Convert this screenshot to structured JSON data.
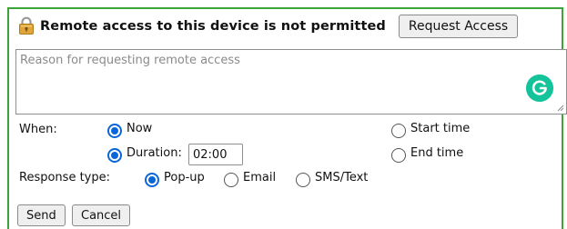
{
  "header": {
    "title": "Remote access to this device is not permitted",
    "request_button": "Request Access",
    "icon": "lock-icon"
  },
  "reason": {
    "placeholder": "Reason for requesting remote access",
    "value": ""
  },
  "when": {
    "label": "When:",
    "now_label": "Now",
    "now_selected": true,
    "duration_label": "Duration:",
    "duration_selected": true,
    "duration_value": "02:00",
    "start_time_label": "Start time",
    "start_time_selected": false,
    "end_time_label": "End time",
    "end_time_selected": false
  },
  "response": {
    "label": "Response type:",
    "options": [
      {
        "label": "Pop-up",
        "selected": true
      },
      {
        "label": "Email",
        "selected": false
      },
      {
        "label": "SMS/Text",
        "selected": false
      }
    ]
  },
  "actions": {
    "send": "Send",
    "cancel": "Cancel"
  },
  "colors": {
    "frame_border": "#3aa63a",
    "radio_accent": "#0a66d8",
    "grammarly": "#15c39a"
  }
}
